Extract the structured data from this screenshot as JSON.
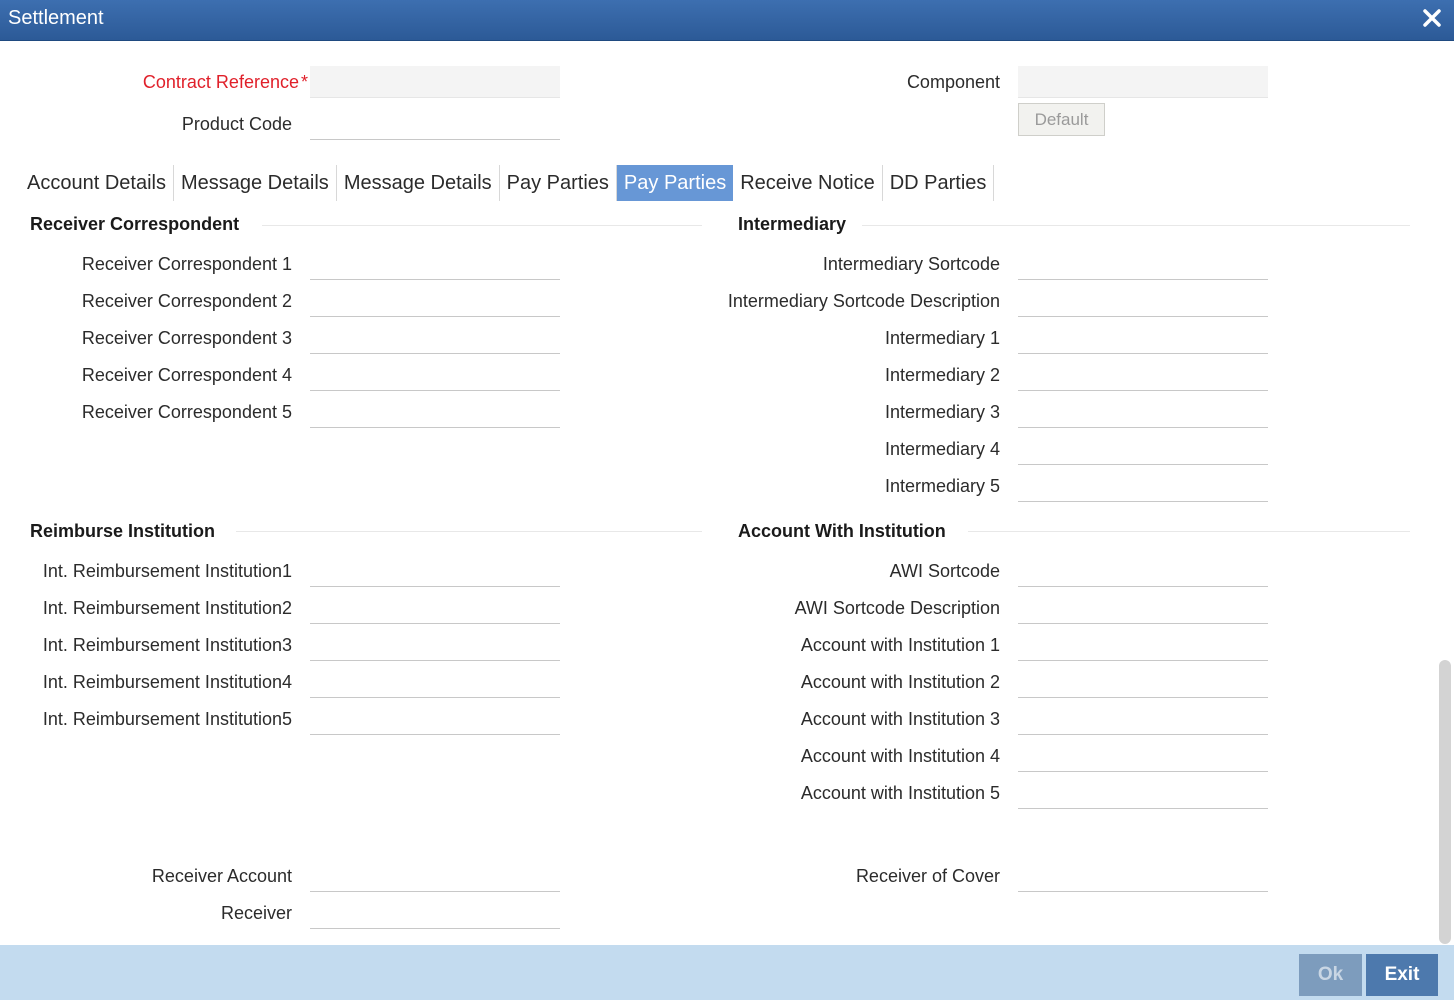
{
  "window": {
    "title": "Settlement"
  },
  "header": {
    "contract_reference_label": "Contract Reference",
    "required_marker": "*",
    "product_code_label": "Product Code",
    "component_label": "Component",
    "default_button": "Default"
  },
  "tabs": [
    {
      "label": "Account Details"
    },
    {
      "label": "Message Details"
    },
    {
      "label": "Message Details"
    },
    {
      "label": "Pay Parties"
    },
    {
      "label": "Pay Parties",
      "active": true
    },
    {
      "label": "Receive Notice"
    },
    {
      "label": "DD Parties"
    }
  ],
  "receiver_correspondent": {
    "heading": "Receiver Correspondent",
    "fields": [
      "Receiver Correspondent 1",
      "Receiver Correspondent 2",
      "Receiver Correspondent 3",
      "Receiver Correspondent 4",
      "Receiver Correspondent 5"
    ]
  },
  "intermediary": {
    "heading": "Intermediary",
    "fields": [
      "Intermediary Sortcode",
      "Intermediary Sortcode Description",
      "Intermediary 1",
      "Intermediary 2",
      "Intermediary 3",
      "Intermediary 4",
      "Intermediary 5"
    ]
  },
  "reimburse_institution": {
    "heading": "Reimburse Institution",
    "fields": [
      "Int. Reimbursement Institution1",
      "Int. Reimbursement Institution2",
      "Int. Reimbursement Institution3",
      "Int. Reimbursement Institution4",
      "Int. Reimbursement Institution5"
    ]
  },
  "account_with_institution": {
    "heading": "Account With Institution",
    "fields": [
      "AWI Sortcode",
      "AWI Sortcode Description",
      "Account with Institution 1",
      "Account with Institution 2",
      "Account with Institution 3",
      "Account with Institution 4",
      "Account with Institution 5"
    ]
  },
  "bottom": {
    "receiver_account_label": "Receiver Account",
    "receiver_label": "Receiver",
    "receiver_of_cover_label": "Receiver of Cover"
  },
  "footer": {
    "ok_label": "Ok",
    "exit_label": "Exit"
  },
  "colors": {
    "titlebar": "#2c5a97",
    "active_tab": "#6797d6",
    "footer": "#c3dbef",
    "required": "#e0202a"
  }
}
